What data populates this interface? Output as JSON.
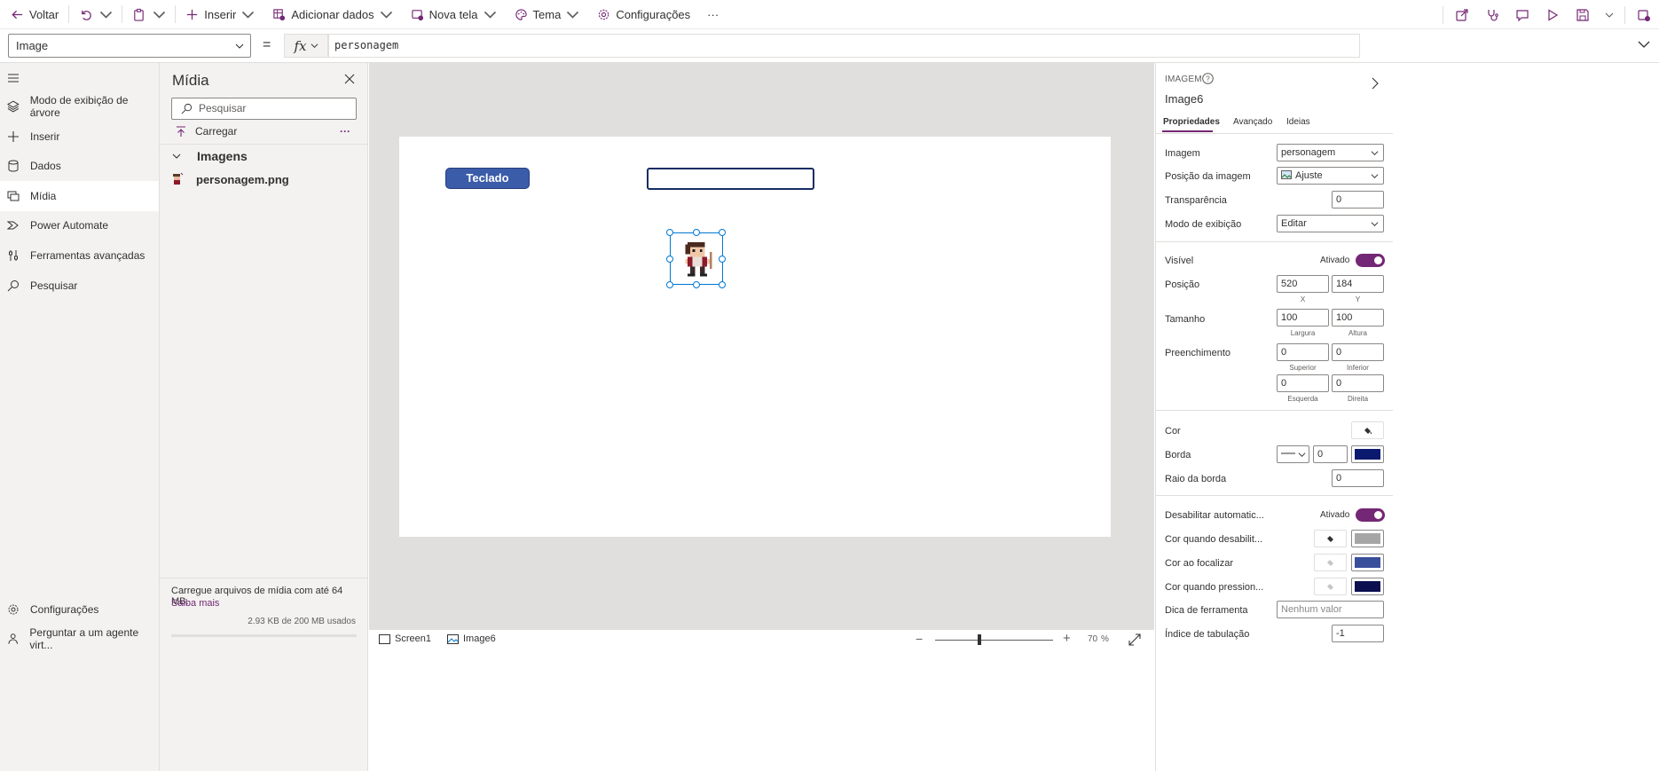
{
  "toolbar": {
    "back_label": "Voltar",
    "insert_label": "Inserir",
    "add_data_label": "Adicionar dados",
    "new_screen_label": "Nova tela",
    "theme_label": "Tema",
    "settings_label": "Configurações",
    "more_label": "···"
  },
  "formula": {
    "property": "Image",
    "equals": "=",
    "fx": "fx",
    "value": "personagem"
  },
  "leftnav": {
    "items": [
      {
        "label": "Modo de exibição de árvore",
        "icon": "layers-icon"
      },
      {
        "label": "Inserir",
        "icon": "plus-icon"
      },
      {
        "label": "Dados",
        "icon": "database-icon"
      },
      {
        "label": "Mídia",
        "icon": "media-icon"
      },
      {
        "label": "Power Automate",
        "icon": "power-automate-icon"
      },
      {
        "label": "Ferramentas avançadas",
        "icon": "tools-icon"
      },
      {
        "label": "Pesquisar",
        "icon": "search-icon"
      }
    ],
    "bottom": [
      {
        "label": "Configurações",
        "icon": "gear-icon"
      },
      {
        "label": "Perguntar a um agente virt...",
        "icon": "agent-icon"
      }
    ]
  },
  "media": {
    "title": "Mídia",
    "search_placeholder": "Pesquisar",
    "upload_label": "Carregar",
    "more": "···",
    "group_label": "Imagens",
    "files": [
      "personagem.png"
    ],
    "footer_text": "Carregue arquivos de mídia com até 64 MB.",
    "footer_link": "Saiba mais",
    "usage": "2.93 KB de 200 MB usados",
    "usage_fraction": 1e-05
  },
  "canvas": {
    "button_label": "Teclado"
  },
  "statusbar": {
    "screen_tab": "Screen1",
    "control_tab": "Image6",
    "zoom_value": "70",
    "zoom_unit": "%",
    "zoom_minus": "−",
    "zoom_plus": "+"
  },
  "properties": {
    "type_label": "IMAGEM",
    "control_name": "Image6",
    "tabs": [
      "Propriedades",
      "Avançado",
      "Ideias"
    ],
    "image_label": "Imagem",
    "image_value": "personagem",
    "image_position_label": "Posição da imagem",
    "image_position_value": "Ajuste",
    "transparency_label": "Transparência",
    "transparency_value": "0",
    "display_mode_label": "Modo de exibição",
    "display_mode_value": "Editar",
    "visible_label": "Visível",
    "visible_state": "Ativado",
    "position_label": "Posição",
    "x_value": "520",
    "y_value": "184",
    "x_caption": "X",
    "y_caption": "Y",
    "size_label": "Tamanho",
    "width_value": "100",
    "height_value": "100",
    "width_caption": "Largura",
    "height_caption": "Altura",
    "padding_label": "Preenchimento",
    "pad_top": "0",
    "pad_bottom": "0",
    "pad_top_caption": "Superior",
    "pad_bottom_caption": "Inferior",
    "pad_left": "0",
    "pad_right": "0",
    "pad_left_caption": "Esquerda",
    "pad_right_caption": "Direita",
    "color_label": "Cor",
    "border_label": "Borda",
    "border_value": "0",
    "border_color": "#0b1a6e",
    "radius_label": "Raio da borda",
    "radius_value": "0",
    "auto_disable_label": "Desabilitar automatic...",
    "auto_disable_state": "Ativado",
    "disabled_color_label": "Cor quando desabilit...",
    "disabled_color": "#a6a6a6",
    "hover_color_label": "Cor ao focalizar",
    "hover_color": "#3a4f9b",
    "pressed_color_label": "Cor quando pression...",
    "pressed_color": "#0b0e4f",
    "tooltip_label": "Dica de ferramenta",
    "tooltip_placeholder": "Nenhum valor",
    "tab_index_label": "Índice de tabulação",
    "tab_index_value": "-1"
  },
  "colors": {
    "accent": "#742774",
    "button": "#3b5ca9",
    "selection": "#0078d4"
  }
}
